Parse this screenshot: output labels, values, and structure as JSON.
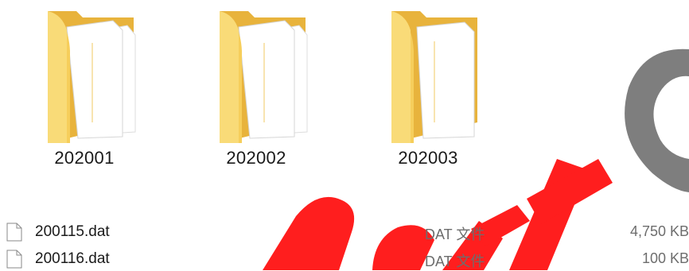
{
  "folders": [
    {
      "name": "202001",
      "icon": "open-folder-icon"
    },
    {
      "name": "202002",
      "icon": "open-folder-icon"
    },
    {
      "name": "202003",
      "icon": "open-folder-icon"
    }
  ],
  "files": [
    {
      "name": "200115.dat",
      "type": "DAT 文件",
      "size": "4,750 KB",
      "icon": "file-icon"
    },
    {
      "name": "200116.dat",
      "type": "DAT 文件",
      "size": "100 KB",
      "icon": "file-icon"
    }
  ],
  "colors": {
    "folder_back": "#E8B33C",
    "folder_front": "#F6CE5B",
    "folder_front_light": "#F9DB78",
    "paper": "#FFFFFF",
    "watermark_red": "#FF1E1E",
    "watermark_gray": "#808080"
  }
}
